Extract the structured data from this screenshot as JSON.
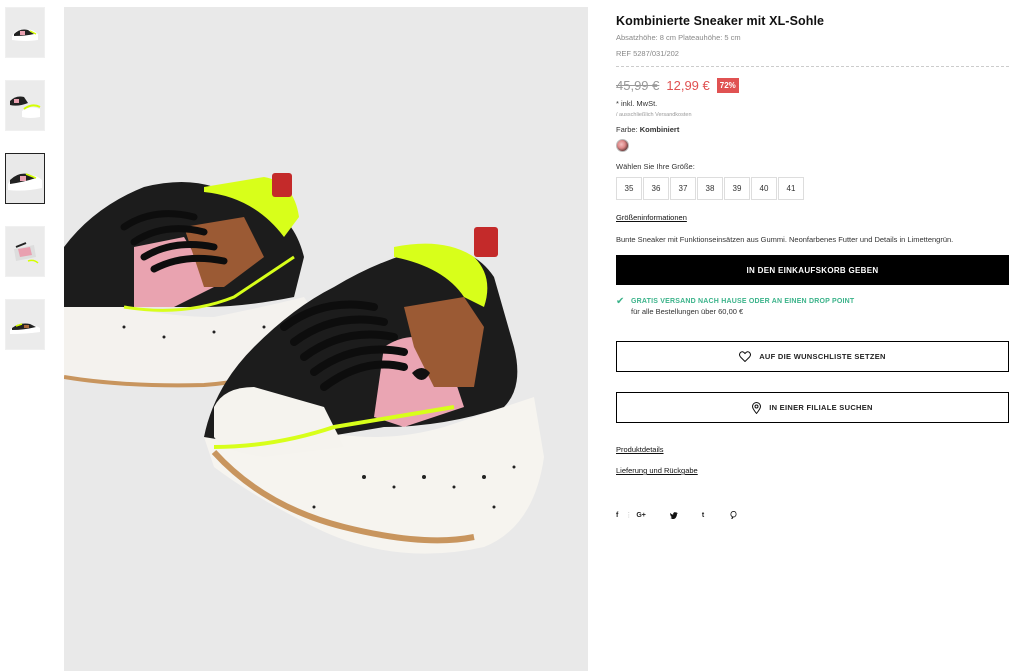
{
  "product": {
    "title": "Kombinierte Sneaker mit XL-Sohle",
    "subtitle": "Absatzhöhe: 8 cm Plateauhöhe: 5 cm",
    "ref": "REF 5287/031/202",
    "old_price": "45,99 €",
    "new_price": "12,99 €",
    "discount": "72%",
    "tax": "* inkl. MwSt.",
    "ship_note": "/ ausschließlich Versandkosten",
    "color_label": "Farbe: ",
    "color_value": "Kombiniert",
    "size_label": "Wählen Sie Ihre Größe:",
    "sizes": [
      "35",
      "36",
      "37",
      "38",
      "39",
      "40",
      "41"
    ],
    "size_info": "Größeninformationen",
    "description": "Bunte Sneaker mit Funktionseinsätzen aus Gummi. Neonfarbenes Futter und Details in Limettengrün."
  },
  "actions": {
    "cart": "IN DEN EINKAUFSKORB GEBEN",
    "wishlist": "AUF DIE WUNSCHLISTE SETZEN",
    "store": "IN EINER FILIALE SUCHEN"
  },
  "shipping": {
    "title": "GRATIS VERSAND NACH HAUSE ODER AN EINEN DROP POINT",
    "sub": "für alle Bestellungen über 60,00 €"
  },
  "links": {
    "details": "Produktdetails",
    "delivery": "Lieferung und Rückgabe"
  },
  "social": [
    "f",
    "G+",
    "t"
  ],
  "colors": {
    "accent": "#e05252",
    "success": "#3bb38a",
    "primary": "#000000"
  }
}
